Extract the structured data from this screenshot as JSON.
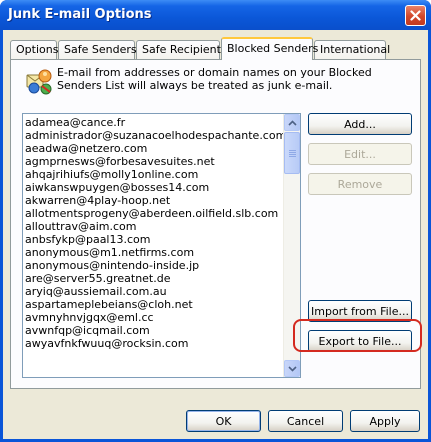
{
  "window": {
    "title": "Junk E-mail Options"
  },
  "tabs": [
    {
      "label": "Options",
      "active": false
    },
    {
      "label": "Safe Senders",
      "active": false
    },
    {
      "label": "Safe Recipients",
      "active": false
    },
    {
      "label": "Blocked Senders",
      "active": true
    },
    {
      "label": "International",
      "active": false
    }
  ],
  "info": {
    "text": "E-mail from addresses or domain names on your Blocked Senders List will always be treated as junk e-mail."
  },
  "blocked_list": [
    "adamea@cance.fr",
    "administrador@suzanacoelhodespachante.com",
    "aeadwa@netzero.com",
    "agmprnesws@forbesavesuites.net",
    "ahqajrihiufs@molly1online.com",
    "aiwkanswpuygen@bosses14.com",
    "akwarren@4play-hoop.net",
    "allotmentsprogeny@aberdeen.oilfield.slb.com",
    "allouttrav@aim.com",
    "anbsfykp@paal13.com",
    "anonymous@m1.netfirms.com",
    "anonymous@nintendo-inside.jp",
    "are@server55.greatnet.de",
    "aryiq@aussiemail.com.au",
    "aspartameplebeians@cloh.net",
    "avmnyhnvjgqx@eml.cc",
    "avwnfqp@icqmail.com",
    "awyavfnkfwuuq@rocksin.com"
  ],
  "side_buttons": {
    "add": "Add...",
    "edit": "Edit...",
    "remove": "Remove",
    "import": "Import from File...",
    "export": "Export to File..."
  },
  "dialog_buttons": {
    "ok": "OK",
    "cancel": "Cancel",
    "apply": "Apply"
  },
  "colors": {
    "titlebar": "#0a55d8",
    "highlight_ring": "#d42a20",
    "active_tab_accent": "#ffc83c"
  }
}
